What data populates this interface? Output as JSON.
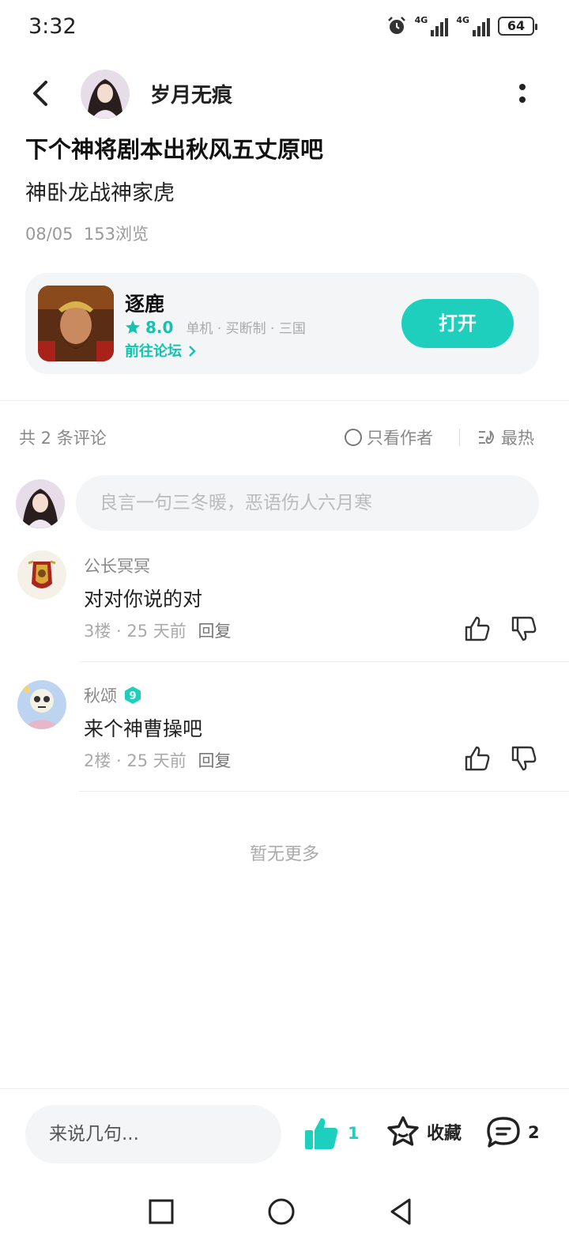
{
  "status_bar": {
    "time": "3:32",
    "network_1": "4G",
    "network_2": "4G",
    "battery": "64",
    "icons": [
      "alarm-icon",
      "signal-icon",
      "signal-icon",
      "battery-icon"
    ]
  },
  "header": {
    "author_name": "岁月无痕",
    "icons": [
      "back-arrow-icon",
      "more-vertical-icon"
    ]
  },
  "post": {
    "title": "下个神将剧本出秋风五丈原吧",
    "body": "神卧龙战神家虎",
    "date": "08/05",
    "views": "153浏览"
  },
  "game_card": {
    "name": "逐鹿",
    "rating": "8.0",
    "tags": "单机 · 买断制 · 三国",
    "forum_link": "前往论坛",
    "open_button": "打开",
    "accent": "#1fcfbd"
  },
  "comments_header": {
    "count_text": "共 2 条评论",
    "only_author": "只看作者",
    "sort": "最热"
  },
  "comment_input": {
    "placeholder": "良言一句三冬暖，恶语伤人六月寒"
  },
  "comments": [
    {
      "user": "公长冥冥",
      "text": "对对你说的对",
      "meta": "3楼 · 25 天前",
      "reply": "回复"
    },
    {
      "user": "秋颂",
      "level": "9",
      "text": "来个神曹操吧",
      "meta": "2楼 · 25 天前",
      "reply": "回复"
    }
  ],
  "footer_text": "暂无更多",
  "bottom_bar": {
    "input_placeholder": "来说几句...",
    "like_count": "1",
    "favorite_label": "收藏",
    "comment_count": "2"
  }
}
